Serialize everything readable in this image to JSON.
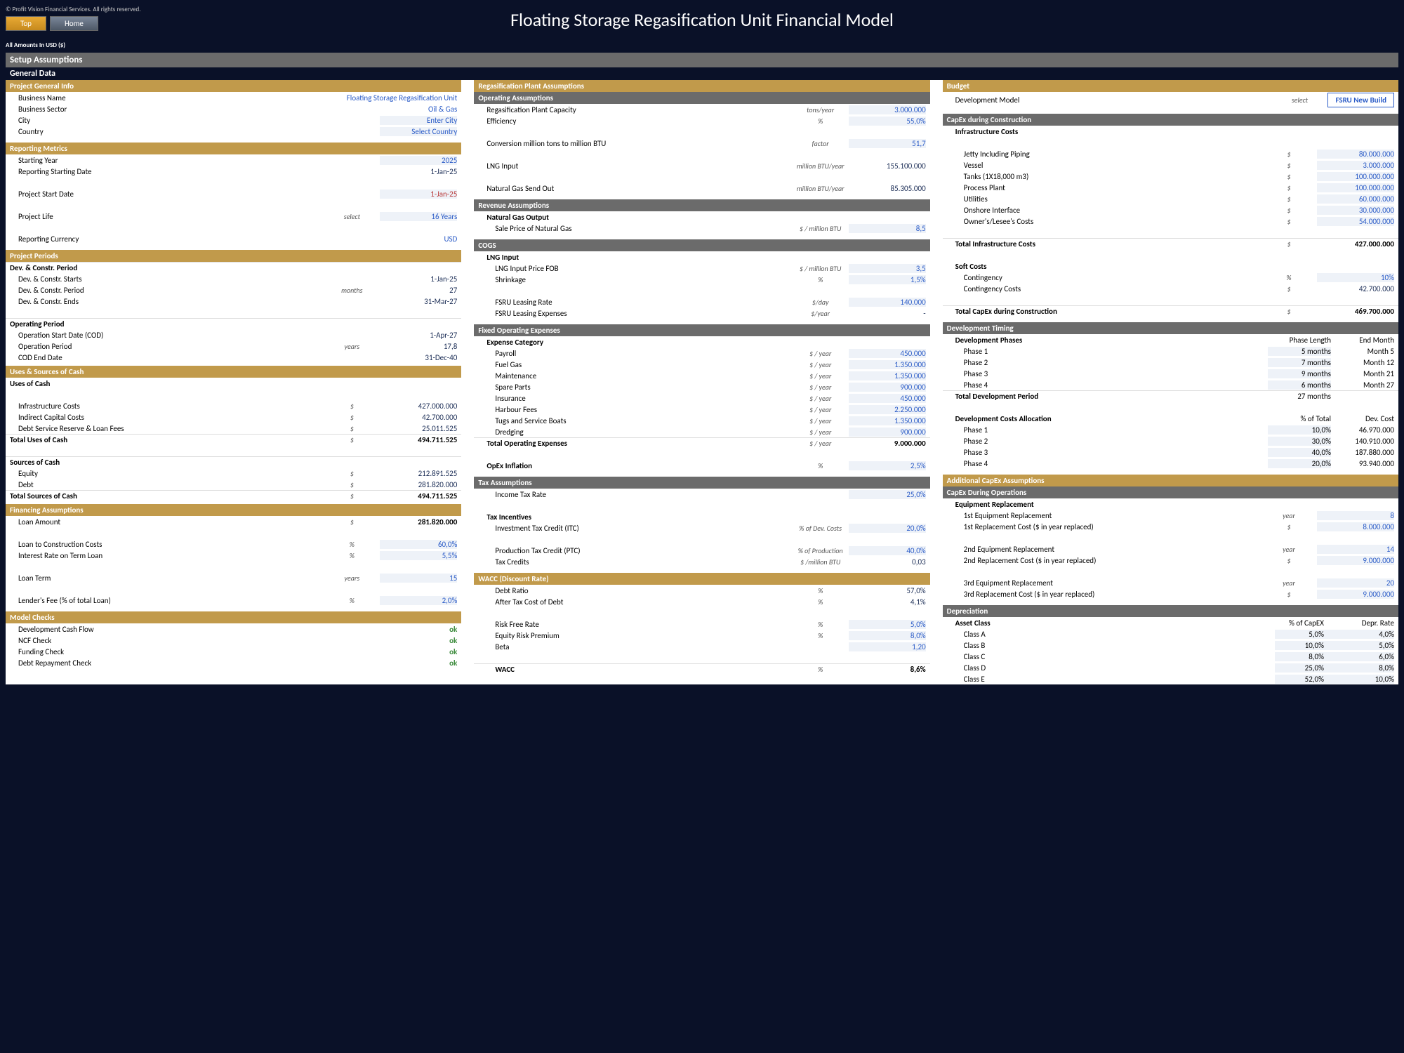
{
  "copyright": "© Profit Vision Financial Services. All rights reserved.",
  "btn": {
    "top": "Top",
    "home": "Home"
  },
  "title": "Floating Storage Regasification Unit Financial Model",
  "note": "All Amounts In  USD ($)",
  "bar": {
    "setup": "Setup Assumptions",
    "general": "General Data"
  },
  "h": {
    "pgi": "Project General Info",
    "rm": "Reporting Metrics",
    "pp": "Project Periods",
    "usc": "Uses & Sources of Cash",
    "fa": "Financing Assumptions",
    "mc": "Model Checks",
    "rpa": "Regasification Plant Assumptions",
    "oa": "Operating Assumptions",
    "ra": "Revenue Assumptions",
    "cogs": "COGS",
    "foe": "Fixed Operating Expenses",
    "ta": "Tax Assumptions",
    "wacc": "WACC (Discount Rate)",
    "bud": "Budget",
    "cxc": "CapEx during Construction",
    "dt": "Development Timing",
    "aca": "Additional CapEx Assumptions",
    "cxo": "CapEx During Operations",
    "dep": "Depreciation"
  },
  "pgi": {
    "bn": {
      "l": "Business Name",
      "v": "Floating Storage Regasification Unit"
    },
    "bs": {
      "l": "Business Sector",
      "v": "Oil & Gas"
    },
    "city": {
      "l": "City",
      "v": "Enter City"
    },
    "country": {
      "l": "Country",
      "v": "Select Country"
    }
  },
  "rm": {
    "sy": {
      "l": "Starting Year",
      "v": "2025"
    },
    "rsd": {
      "l": "Reporting Starting Date",
      "v": "1-Jan-25"
    },
    "psd": {
      "l": "Project Start Date",
      "v": "1-Jan-25"
    },
    "pl": {
      "l": "Project Life",
      "u": "select",
      "v": "16 Years"
    },
    "rc": {
      "l": "Reporting Currency",
      "v": "USD"
    }
  },
  "pp": {
    "dcp": {
      "l": "Dev. & Constr. Period"
    },
    "dcs": {
      "l": "Dev. & Constr. Starts",
      "v": "1-Jan-25"
    },
    "dcper": {
      "l": "Dev. & Constr. Period",
      "u": "months",
      "v": "27"
    },
    "dce": {
      "l": "Dev. & Constr. Ends",
      "v": "31-Mar-27"
    },
    "op": {
      "l": "Operating Period"
    },
    "osd": {
      "l": "Operation Start Date (COD)",
      "v": "1-Apr-27"
    },
    "oper": {
      "l": "Operation Period",
      "u": "years",
      "v": "17,8"
    },
    "ced": {
      "l": "COD End Date",
      "v": "31-Dec-40"
    }
  },
  "usc": {
    "uoc": {
      "l": "Uses of Cash"
    },
    "ic": {
      "l": "Infrastructure Costs",
      "u": "$",
      "v": "427.000.000"
    },
    "icc": {
      "l": "Indirect Capital Costs",
      "u": "$",
      "v": "42.700.000"
    },
    "dsr": {
      "l": "Debt Service Reserve & Loan Fees",
      "u": "$",
      "v": "25.011.525"
    },
    "tuc": {
      "l": "Total Uses of Cash",
      "u": "$",
      "v": "494.711.525"
    },
    "soc": {
      "l": "Sources of Cash"
    },
    "eq": {
      "l": "Equity",
      "u": "$",
      "v": "212.891.525"
    },
    "debt": {
      "l": "Debt",
      "u": "$",
      "v": "281.820.000"
    },
    "tsc": {
      "l": "Total Sources of Cash",
      "u": "$",
      "v": "494.711.525"
    }
  },
  "fa": {
    "la": {
      "l": "Loan Amount",
      "u": "$",
      "v": "281.820.000"
    },
    "lcc": {
      "l": "Loan to Construction Costs",
      "u": "%",
      "v": "60,0%"
    },
    "ir": {
      "l": "Interest Rate on Term Loan",
      "u": "%",
      "v": "5,5%"
    },
    "lt": {
      "l": "Loan Term",
      "u": "years",
      "v": "15"
    },
    "lf": {
      "l": "Lender's Fee (% of total Loan)",
      "u": "%",
      "v": "2,0%"
    }
  },
  "mc": {
    "dcf": {
      "l": "Development Cash Flow",
      "v": "ok"
    },
    "ncf": {
      "l": "NCF Check",
      "v": "ok"
    },
    "fc": {
      "l": "Funding Check",
      "v": "ok"
    },
    "drc": {
      "l": "Debt Repayment Check",
      "v": "ok"
    }
  },
  "oa": {
    "rpc": {
      "l": "Regasification Plant Capacity",
      "u": "tons/year",
      "v": "3.000.000"
    },
    "eff": {
      "l": "Efficiency",
      "u": "%",
      "v": "55,0%"
    },
    "conv": {
      "l": "Conversion million tons to million BTU",
      "u": "factor",
      "v": "51,7"
    },
    "lng": {
      "l": "LNG Input",
      "u": "million BTU/year",
      "v": "155.100.000"
    },
    "ngo": {
      "l": "Natural Gas Send Out",
      "u": "million BTU/year",
      "v": "85.305.000"
    }
  },
  "ra": {
    "ngo": {
      "l": "Natural Gas Output"
    },
    "sp": {
      "l": "Sale Price of Natural Gas",
      "u": "$ / million BTU",
      "v": "8,5"
    }
  },
  "cogs": {
    "lngi": {
      "l": "LNG Input"
    },
    "lngp": {
      "l": "LNG Input Price FOB",
      "u": "$ / million BTU",
      "v": "3,5"
    },
    "shr": {
      "l": "Shrinkage",
      "u": "%",
      "v": "1,5%"
    },
    "flr": {
      "l": "FSRU Leasing Rate",
      "u": "$/day",
      "v": "140.000"
    },
    "fle": {
      "l": "FSRU Leasing Expenses",
      "u": "$/year",
      "v": "-"
    }
  },
  "foe": {
    "ec": {
      "l": "Expense Category"
    },
    "pay": {
      "l": "Payroll",
      "u": "$ / year",
      "v": "450.000"
    },
    "fg": {
      "l": "Fuel Gas",
      "u": "$ / year",
      "v": "1.350.000"
    },
    "mnt": {
      "l": "Maintenance",
      "u": "$ / year",
      "v": "1.350.000"
    },
    "sp": {
      "l": "Spare Parts",
      "u": "$ / year",
      "v": "900.000"
    },
    "ins": {
      "l": "Insurance",
      "u": "$ / year",
      "v": "450.000"
    },
    "hf": {
      "l": "Harbour Fees",
      "u": "$ / year",
      "v": "2.250.000"
    },
    "tsb": {
      "l": "Tugs and Service Boats",
      "u": "$ / year",
      "v": "1.350.000"
    },
    "drg": {
      "l": "Dredging",
      "u": "$ / year",
      "v": "900.000"
    },
    "toe": {
      "l": "Total Operating Expenses",
      "u": "$ / year",
      "v": "9.000.000"
    },
    "oi": {
      "l": "OpEx Inflation",
      "u": "%",
      "v": "2,5%"
    }
  },
  "ta": {
    "itr": {
      "l": "Income Tax Rate",
      "v": "25,0%"
    },
    "ti": {
      "l": "Tax Incentives"
    },
    "itc": {
      "l": "Investment Tax Credit (ITC)",
      "u": "% of Dev. Costs",
      "v": "20,0%"
    },
    "ptc": {
      "l": "Production Tax Credit (PTC)",
      "u": "% of Production",
      "v": "40,0%"
    },
    "tc": {
      "l": "Tax Credits",
      "u": "$ /million BTU",
      "v": "0,03"
    }
  },
  "wacc": {
    "dr": {
      "l": "Debt Ratio",
      "u": "%",
      "v": "57,0%"
    },
    "atcd": {
      "l": "After Tax Cost of Debt",
      "u": "%",
      "v": "4,1%"
    },
    "rfr": {
      "l": "Risk Free Rate",
      "u": "%",
      "v": "5,0%"
    },
    "erp": {
      "l": "Equity Risk Premium",
      "u": "%",
      "v": "8,0%"
    },
    "beta": {
      "l": "Beta",
      "v": "1,20"
    },
    "wacc": {
      "l": "WACC",
      "u": "%",
      "v": "8,6%"
    }
  },
  "bud": {
    "dm": {
      "l": "Development Model",
      "u": "select",
      "v": "FSRU New Build"
    },
    "infc": {
      "l": "Infrastructure Costs"
    },
    "jip": {
      "l": "Jetty Including Piping",
      "u": "$",
      "v": "80.000.000"
    },
    "ves": {
      "l": "Vessel",
      "u": "$",
      "v": "3.000.000"
    },
    "tnk": {
      "l": "Tanks (1X18,000 m3)",
      "u": "$",
      "v": "100.000.000"
    },
    "ppl": {
      "l": "Process Plant",
      "u": "$",
      "v": "100.000.000"
    },
    "utl": {
      "l": "Utilities",
      "u": "$",
      "v": "60.000.000"
    },
    "oi": {
      "l": "Onshore Interface",
      "u": "$",
      "v": "30.000.000"
    },
    "olc": {
      "l": "Owner's/Lesee's Costs",
      "u": "$",
      "v": "54.000.000"
    },
    "tic": {
      "l": "Total Infrastructure Costs",
      "u": "$",
      "v": "427.000.000"
    },
    "sc": {
      "l": "Soft Costs"
    },
    "cont": {
      "l": "Contingency",
      "u": "%",
      "v": "10%"
    },
    "cc": {
      "l": "Contingency Costs",
      "u": "$",
      "v": "42.700.000"
    },
    "tcdc": {
      "l": "Total CapEx during Construction",
      "u": "$",
      "v": "469.700.000"
    }
  },
  "dt": {
    "dp": {
      "l": "Development Phases",
      "h1": "Phase Length",
      "h2": "End Month"
    },
    "p1": {
      "l": "Phase 1",
      "v1": "5 months",
      "v2": "Month 5"
    },
    "p2": {
      "l": "Phase 2",
      "v1": "7 months",
      "v2": "Month 12"
    },
    "p3": {
      "l": "Phase 3",
      "v1": "9 months",
      "v2": "Month 21"
    },
    "p4": {
      "l": "Phase 4",
      "v1": "6 months",
      "v2": "Month 27"
    },
    "tdp": {
      "l": "Total Development Period",
      "v1": "27 months"
    },
    "dca": {
      "l": "Development Costs Allocation",
      "h1": "% of Total",
      "h2": "Dev. Cost"
    },
    "a1": {
      "l": "Phase 1",
      "v1": "10,0%",
      "v2": "46.970.000"
    },
    "a2": {
      "l": "Phase 2",
      "v1": "30,0%",
      "v2": "140.910.000"
    },
    "a3": {
      "l": "Phase 3",
      "v1": "40,0%",
      "v2": "187.880.000"
    },
    "a4": {
      "l": "Phase 4",
      "v1": "20,0%",
      "v2": "93.940.000"
    }
  },
  "cxo": {
    "er": {
      "l": "Equipment Replacement"
    },
    "e1": {
      "l": "1st Equipment Replacement",
      "u": "year",
      "v": "8"
    },
    "c1": {
      "l": "1st Replacement Cost  ($ in year replaced)",
      "u": "$",
      "v": "8.000.000"
    },
    "e2": {
      "l": "2nd Equipment Replacement",
      "u": "year",
      "v": "14"
    },
    "c2": {
      "l": "2nd Replacement Cost  ($ in year replaced)",
      "u": "$",
      "v": "9.000.000"
    },
    "e3": {
      "l": "3rd Equipment Replacement",
      "u": "year",
      "v": "20"
    },
    "c3": {
      "l": "3rd Replacement Cost  ($ in year replaced)",
      "u": "$",
      "v": "9.000.000"
    }
  },
  "dep": {
    "ac": {
      "l": "Asset Class",
      "h1": "% of CapEX",
      "h2": "Depr. Rate"
    },
    "a": {
      "l": "Class A",
      "v1": "5,0%",
      "v2": "4,0%"
    },
    "b": {
      "l": "Class B",
      "v1": "10,0%",
      "v2": "5,0%"
    },
    "c": {
      "l": "Class C",
      "v1": "8,0%",
      "v2": "6,0%"
    },
    "d": {
      "l": "Class D",
      "v1": "25,0%",
      "v2": "8,0%"
    },
    "e": {
      "l": "Class E",
      "v1": "52,0%",
      "v2": "10,0%"
    }
  }
}
